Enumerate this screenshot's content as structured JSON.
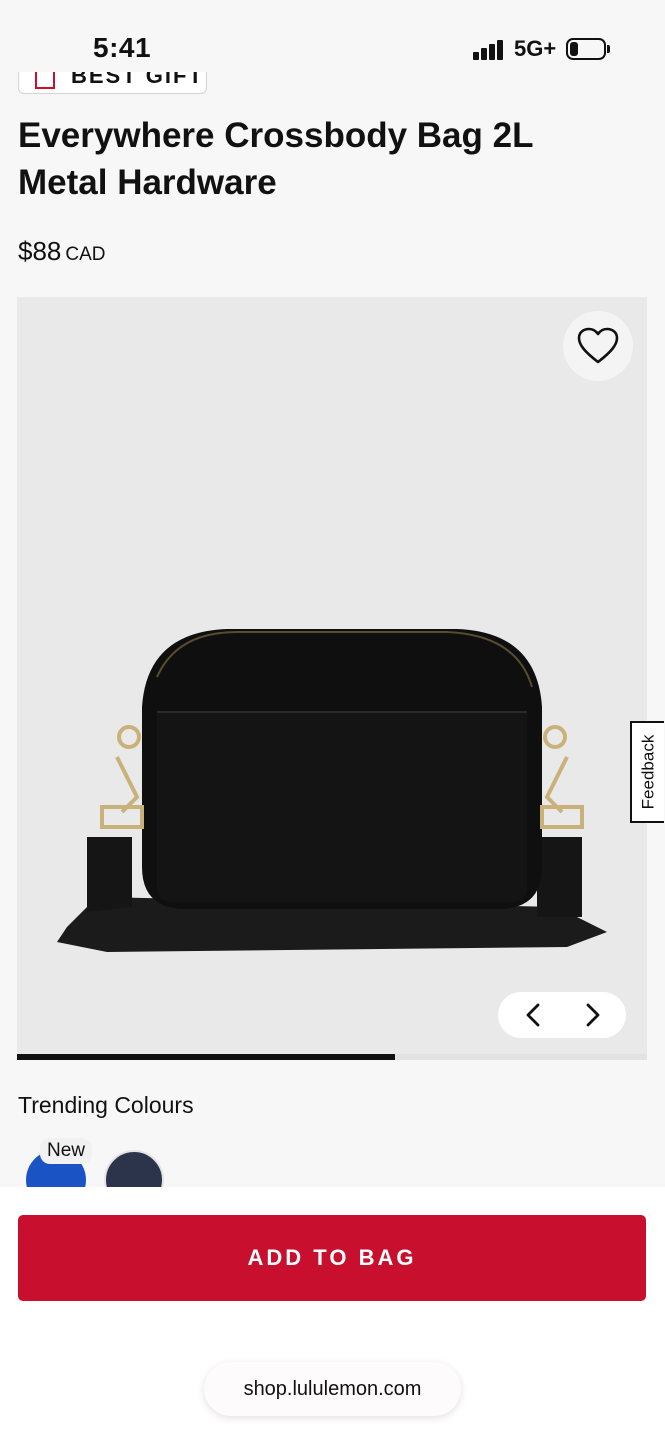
{
  "status_bar": {
    "time": "5:41",
    "network": "5G+",
    "battery_level_pct": 25
  },
  "product": {
    "badge": "BEST GIFT",
    "title": "Everywhere Crossbody Bag 2L Metal Hardware",
    "price": "$88",
    "currency": "CAD"
  },
  "carousel": {
    "wishlist_icon": "heart-outline-icon",
    "prev_icon": "chevron-left-icon",
    "next_icon": "chevron-right-icon",
    "progress_fraction": 0.6
  },
  "feedback": {
    "label": "Feedback"
  },
  "colours": {
    "heading": "Trending Colours",
    "swatches": [
      {
        "color": "#1a54c4",
        "tag": "New"
      },
      {
        "color": "#2b344a"
      }
    ]
  },
  "cta": {
    "add_to_bag": "ADD TO BAG"
  },
  "browser": {
    "url": "shop.lululemon.com"
  },
  "colors": {
    "accent": "#c8102e"
  }
}
